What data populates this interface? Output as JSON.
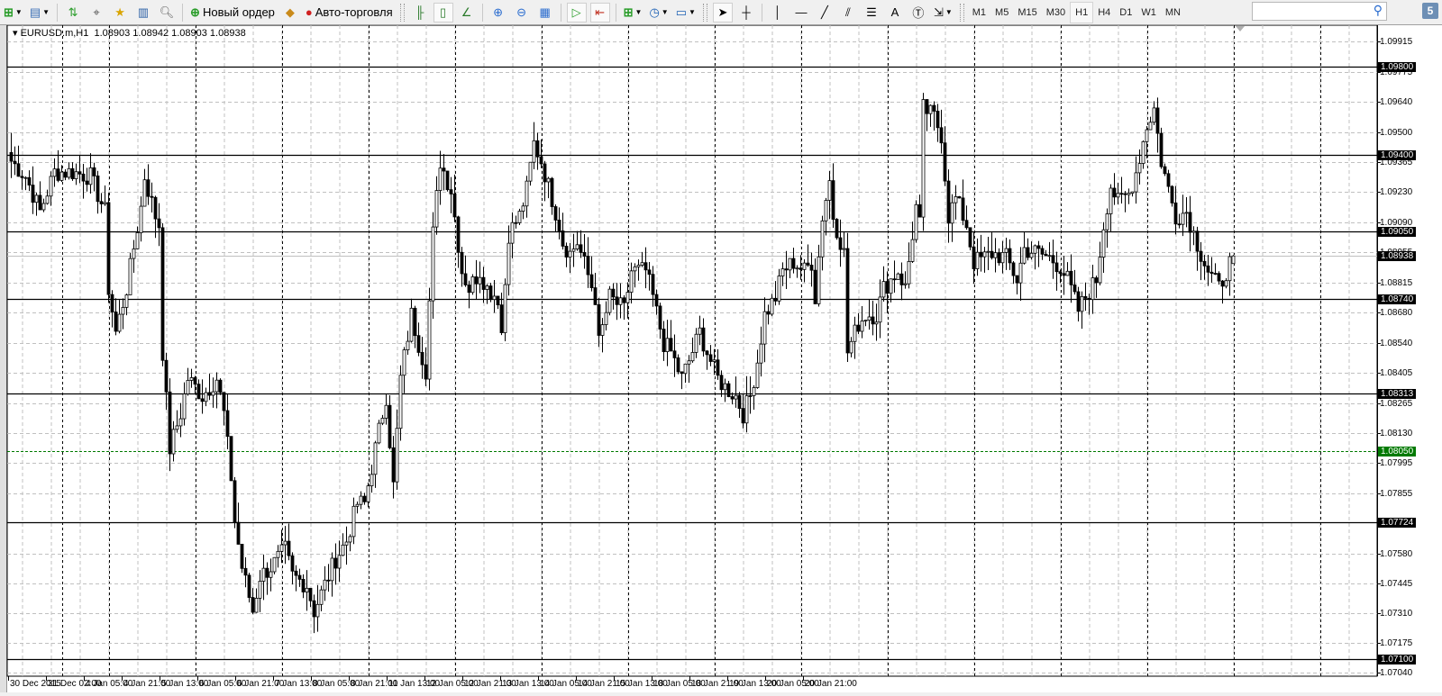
{
  "toolbar": {
    "new_order_label": "Новый ордер",
    "autotrading_label": "Авто-торговля",
    "timeframes": [
      "M1",
      "M5",
      "M15",
      "M30",
      "H1",
      "H4",
      "D1",
      "W1",
      "MN"
    ],
    "active_timeframe": "H1",
    "search_placeholder": "",
    "notifications_count": "5"
  },
  "chart_header": {
    "symbol_info": "EURUSD.m,H1  1.08903 1.08942 1.08903 1.08938"
  },
  "chart_data": {
    "type": "candlestick",
    "symbol": "EURUSD.m",
    "timeframe": "H1",
    "ohlc_last": {
      "open": 1.08903,
      "high": 1.08942,
      "low": 1.08903,
      "close": 1.08938
    },
    "ylim": [
      1.0704,
      1.09915
    ],
    "bar_count": 340,
    "close_waypoints": [
      [
        0,
        1.0937
      ],
      [
        4,
        1.093
      ],
      [
        8,
        1.0914
      ],
      [
        12,
        1.0932
      ],
      [
        17,
        1.0932
      ],
      [
        22,
        1.093
      ],
      [
        26,
        1.0914
      ],
      [
        27,
        1.0879
      ],
      [
        29,
        1.0859
      ],
      [
        32,
        1.0879
      ],
      [
        36,
        1.0916
      ],
      [
        37,
        1.093
      ],
      [
        40,
        1.0912
      ],
      [
        41,
        1.0908
      ],
      [
        42,
        1.085
      ],
      [
        44,
        1.0806
      ],
      [
        47,
        1.0822
      ],
      [
        49,
        1.0838
      ],
      [
        53,
        1.083
      ],
      [
        57,
        1.0838
      ],
      [
        59,
        1.0822
      ],
      [
        61,
        1.0793
      ],
      [
        62,
        1.0773
      ],
      [
        64,
        1.0752
      ],
      [
        67,
        1.0732
      ],
      [
        69,
        1.0748
      ],
      [
        72,
        1.0752
      ],
      [
        76,
        1.076
      ],
      [
        78,
        1.0748
      ],
      [
        82,
        1.0744
      ],
      [
        84,
        1.0732
      ],
      [
        87,
        1.0744
      ],
      [
        90,
        1.0756
      ],
      [
        93,
        1.0764
      ],
      [
        96,
        1.0781
      ],
      [
        98,
        1.0781
      ],
      [
        101,
        1.0806
      ],
      [
        104,
        1.083
      ],
      [
        106,
        1.0789
      ],
      [
        108,
        1.0838
      ],
      [
        111,
        1.0867
      ],
      [
        113,
        1.0854
      ],
      [
        115,
        1.0842
      ],
      [
        117,
        1.0904
      ],
      [
        119,
        1.0937
      ],
      [
        121,
        1.0928
      ],
      [
        122,
        1.0924
      ],
      [
        125,
        1.0887
      ],
      [
        127,
        1.0879
      ],
      [
        130,
        1.0887
      ],
      [
        132,
        1.0879
      ],
      [
        135,
        1.0875
      ],
      [
        136,
        1.0859
      ],
      [
        138,
        1.0904
      ],
      [
        141,
        1.0912
      ],
      [
        143,
        1.0924
      ],
      [
        145,
        1.0945
      ],
      [
        147,
        1.0937
      ],
      [
        150,
        1.092
      ],
      [
        152,
        1.0908
      ],
      [
        153,
        1.09
      ],
      [
        155,
        1.0895
      ],
      [
        157,
        1.09
      ],
      [
        162,
        1.0875
      ],
      [
        163,
        1.0854
      ],
      [
        166,
        1.0875
      ],
      [
        170,
        1.0869
      ],
      [
        172,
        1.0887
      ],
      [
        176,
        1.0887
      ],
      [
        178,
        1.0875
      ],
      [
        181,
        1.0854
      ],
      [
        183,
        1.085
      ],
      [
        186,
        1.0838
      ],
      [
        188,
        1.0846
      ],
      [
        191,
        1.0859
      ],
      [
        193,
        1.085
      ],
      [
        196,
        1.0838
      ],
      [
        198,
        1.0834
      ],
      [
        201,
        1.083
      ],
      [
        203,
        1.0822
      ],
      [
        205,
        1.083
      ],
      [
        207,
        1.0846
      ],
      [
        209,
        1.0867
      ],
      [
        212,
        1.0875
      ],
      [
        214,
        1.0887
      ],
      [
        217,
        1.0891
      ],
      [
        220,
        1.0887
      ],
      [
        222,
        1.0891
      ],
      [
        223,
        1.0875
      ],
      [
        225,
        1.0912
      ],
      [
        227,
        1.0928
      ],
      [
        228,
        1.0912
      ],
      [
        231,
        1.0895
      ],
      [
        232,
        1.085
      ],
      [
        235,
        1.0863
      ],
      [
        237,
        1.0867
      ],
      [
        240,
        1.0867
      ],
      [
        242,
        1.0879
      ],
      [
        246,
        1.0887
      ],
      [
        248,
        1.0879
      ],
      [
        251,
        1.0916
      ],
      [
        252,
        1.0908
      ],
      [
        253,
        1.0961
      ],
      [
        256,
        1.0957
      ],
      [
        258,
        1.0949
      ],
      [
        260,
        1.0912
      ],
      [
        262,
        1.092
      ],
      [
        265,
        1.0908
      ],
      [
        267,
        1.0891
      ],
      [
        270,
        1.0893
      ],
      [
        272,
        1.0895
      ],
      [
        276,
        1.0893
      ],
      [
        279,
        1.0883
      ],
      [
        281,
        1.0897
      ],
      [
        285,
        1.0895
      ],
      [
        288,
        1.0893
      ],
      [
        291,
        1.0889
      ],
      [
        293,
        1.0883
      ],
      [
        296,
        1.0869
      ],
      [
        298,
        1.0875
      ],
      [
        301,
        1.0883
      ],
      [
        303,
        1.0908
      ],
      [
        305,
        1.0926
      ],
      [
        307,
        1.0918
      ],
      [
        310,
        1.0922
      ],
      [
        312,
        1.0932
      ],
      [
        315,
        1.0953
      ],
      [
        317,
        1.0961
      ],
      [
        319,
        1.0937
      ],
      [
        321,
        1.0924
      ],
      [
        323,
        1.0912
      ],
      [
        326,
        1.0914
      ],
      [
        328,
        1.0904
      ],
      [
        330,
        1.0895
      ],
      [
        332,
        1.0887
      ],
      [
        335,
        1.0879
      ],
      [
        337,
        1.0887
      ],
      [
        339,
        1.08938
      ]
    ],
    "price_ticks": [
      "1.09915",
      "1.09775",
      "1.09640",
      "1.09500",
      "1.09365",
      "1.09230",
      "1.09090",
      "1.08955",
      "1.08815",
      "1.08680",
      "1.08540",
      "1.08405",
      "1.08265",
      "1.08130",
      "1.07995",
      "1.07855",
      "1.07580",
      "1.07445",
      "1.07310",
      "1.07175",
      "1.07040"
    ],
    "horizontal_levels": [
      "1.09800",
      "1.09400",
      "1.09050",
      "1.08740",
      "1.08313",
      "1.07724",
      "1.07100"
    ],
    "green_level": "1.08050",
    "current_price": "1.08938",
    "time_labels": [
      "30 Dec 2015",
      "31 Dec 02:00",
      "4 Jan 05:00",
      "4 Jan 21:00",
      "5 Jan 13:00",
      "6 Jan 05:00",
      "6 Jan 21:00",
      "7 Jan 13:00",
      "8 Jan 05:00",
      "8 Jan 21:00",
      "11 Jan 13:00",
      "12 Jan 05:00",
      "12 Jan 21:00",
      "13 Jan 13:00",
      "14 Jan 05:00",
      "14 Jan 21:00",
      "15 Jan 13:00",
      "18 Jan 05:00",
      "18 Jan 21:00",
      "19 Jan 13:00",
      "20 Jan 05:00",
      "20 Jan 21:00"
    ],
    "colors": {
      "bull_body": "#ffffff",
      "bear_body": "#000000",
      "candle_line": "#000000",
      "grid": "#c0c0c0",
      "level": "#000000",
      "green_level": "#007a00",
      "current_line": "#c0c0c0"
    }
  }
}
